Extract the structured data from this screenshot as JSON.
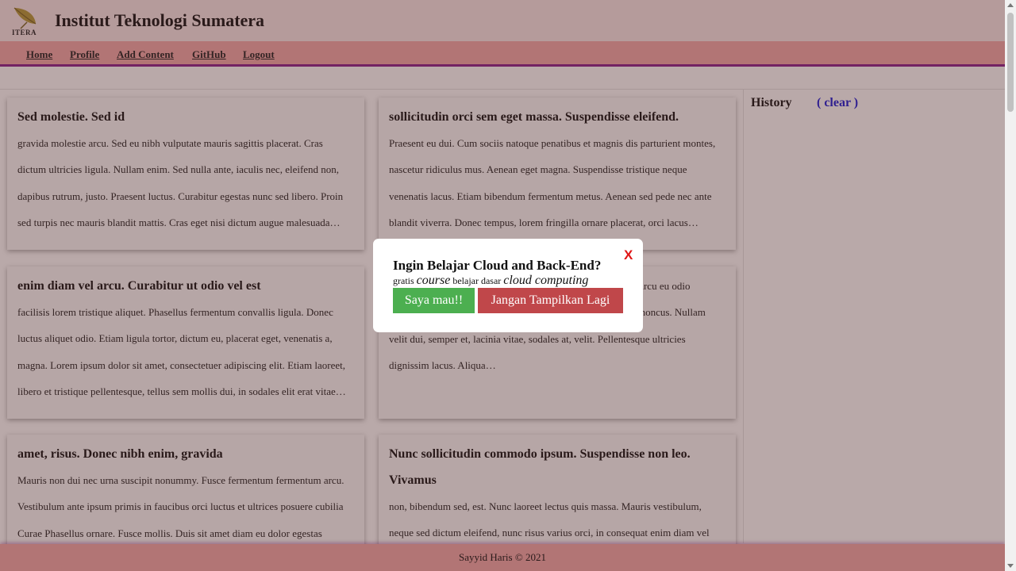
{
  "header": {
    "title": "Institut Teknologi Sumatera",
    "logo_text": "ITERA"
  },
  "nav": {
    "items": [
      {
        "label": "Home"
      },
      {
        "label": "Profile"
      },
      {
        "label": "Add Content"
      },
      {
        "label": "GitHub"
      },
      {
        "label": "Logout"
      }
    ]
  },
  "cards": [
    {
      "title": "Sed molestie. Sed id",
      "body": "gravida molestie arcu. Sed eu nibh vulputate mauris sagittis placerat. Cras dictum ultricies ligula. Nullam enim. Sed nulla ante, iaculis nec, eleifend non, dapibus rutrum, justo. Praesent luctus. Curabitur egestas nunc sed libero. Proin sed turpis nec mauris blandit mattis. Cras eget nisi dictum augue malesuada…"
    },
    {
      "title": "sollicitudin orci sem eget massa. Suspendisse eleifend.",
      "body": "Praesent eu dui. Cum sociis natoque penatibus et magnis dis parturient montes, nascetur ridiculus mus. Aenean eget magna. Suspendisse tristique neque venenatis lacus. Etiam bibendum fermentum metus. Aenean sed pede nec ante blandit viverra. Donec tempus, lorem fringilla ornare placerat, orci lacus…"
    },
    {
      "title": "enim diam vel arcu. Curabitur ut odio vel est",
      "body": "facilisis lorem tristique aliquet. Phasellus fermentum convallis ligula. Donec luctus aliquet odio. Etiam ligula tortor, dictum eu, placerat eget, venenatis a, magna. Lorem ipsum dolor sit amet, consectetuer adipiscing elit. Etiam laoreet, libero et tristique pellentesque, tellus sem mollis dui, in sodales elit erat vitae…"
    },
    {
      "title": "",
      "body": "gnis dis parturient montes, nascetur ridiculus mus. Proin vel arcu eu odio tristique pharetra. Quisque ac libero nec ligula consectetuer rhoncus. Nullam velit dui, semper et, lacinia vitae, sodales at, velit. Pellentesque ultricies dignissim lacus. Aliqua…"
    },
    {
      "title": "amet, risus. Donec nibh enim, gravida",
      "body": "Mauris non dui nec urna suscipit nonummy. Fusce fermentum fermentum arcu. Vestibulum ante ipsum primis in faucibus orci luctus et ultrices posuere cubilia Curae Phasellus ornare. Fusce mollis. Duis sit amet diam eu dolor egestas"
    },
    {
      "title": "Nunc sollicitudin commodo ipsum. Suspendisse non leo. Vivamus",
      "body": "non, bibendum sed, est. Nunc laoreet lectus quis massa. Mauris vestibulum, neque sed dictum eleifend, nunc risus varius orci, in consequat enim diam vel"
    }
  ],
  "sidebar": {
    "title": "History",
    "clear_label": "( clear )"
  },
  "footer": {
    "text": "Sayyid Haris © 2021"
  },
  "modal": {
    "close_label": "X",
    "title": "Ingin Belajar Cloud and Back-End?",
    "sub_1": "gratis ",
    "sub_2": "course",
    "sub_3": " belajar dasar ",
    "sub_4": "cloud computing",
    "yes_label": "Saya mau!!",
    "no_label": "Jangan Tampilkan Lagi"
  },
  "colors": {
    "header_bg": "#f9e8e8",
    "nav_bg": "#f3a8a8",
    "nav_border": "#8a1e8a",
    "accent_green": "#4caf50",
    "accent_red": "#c0474a",
    "close_red": "#e01515",
    "clear_blue": "#1a1ad6"
  }
}
